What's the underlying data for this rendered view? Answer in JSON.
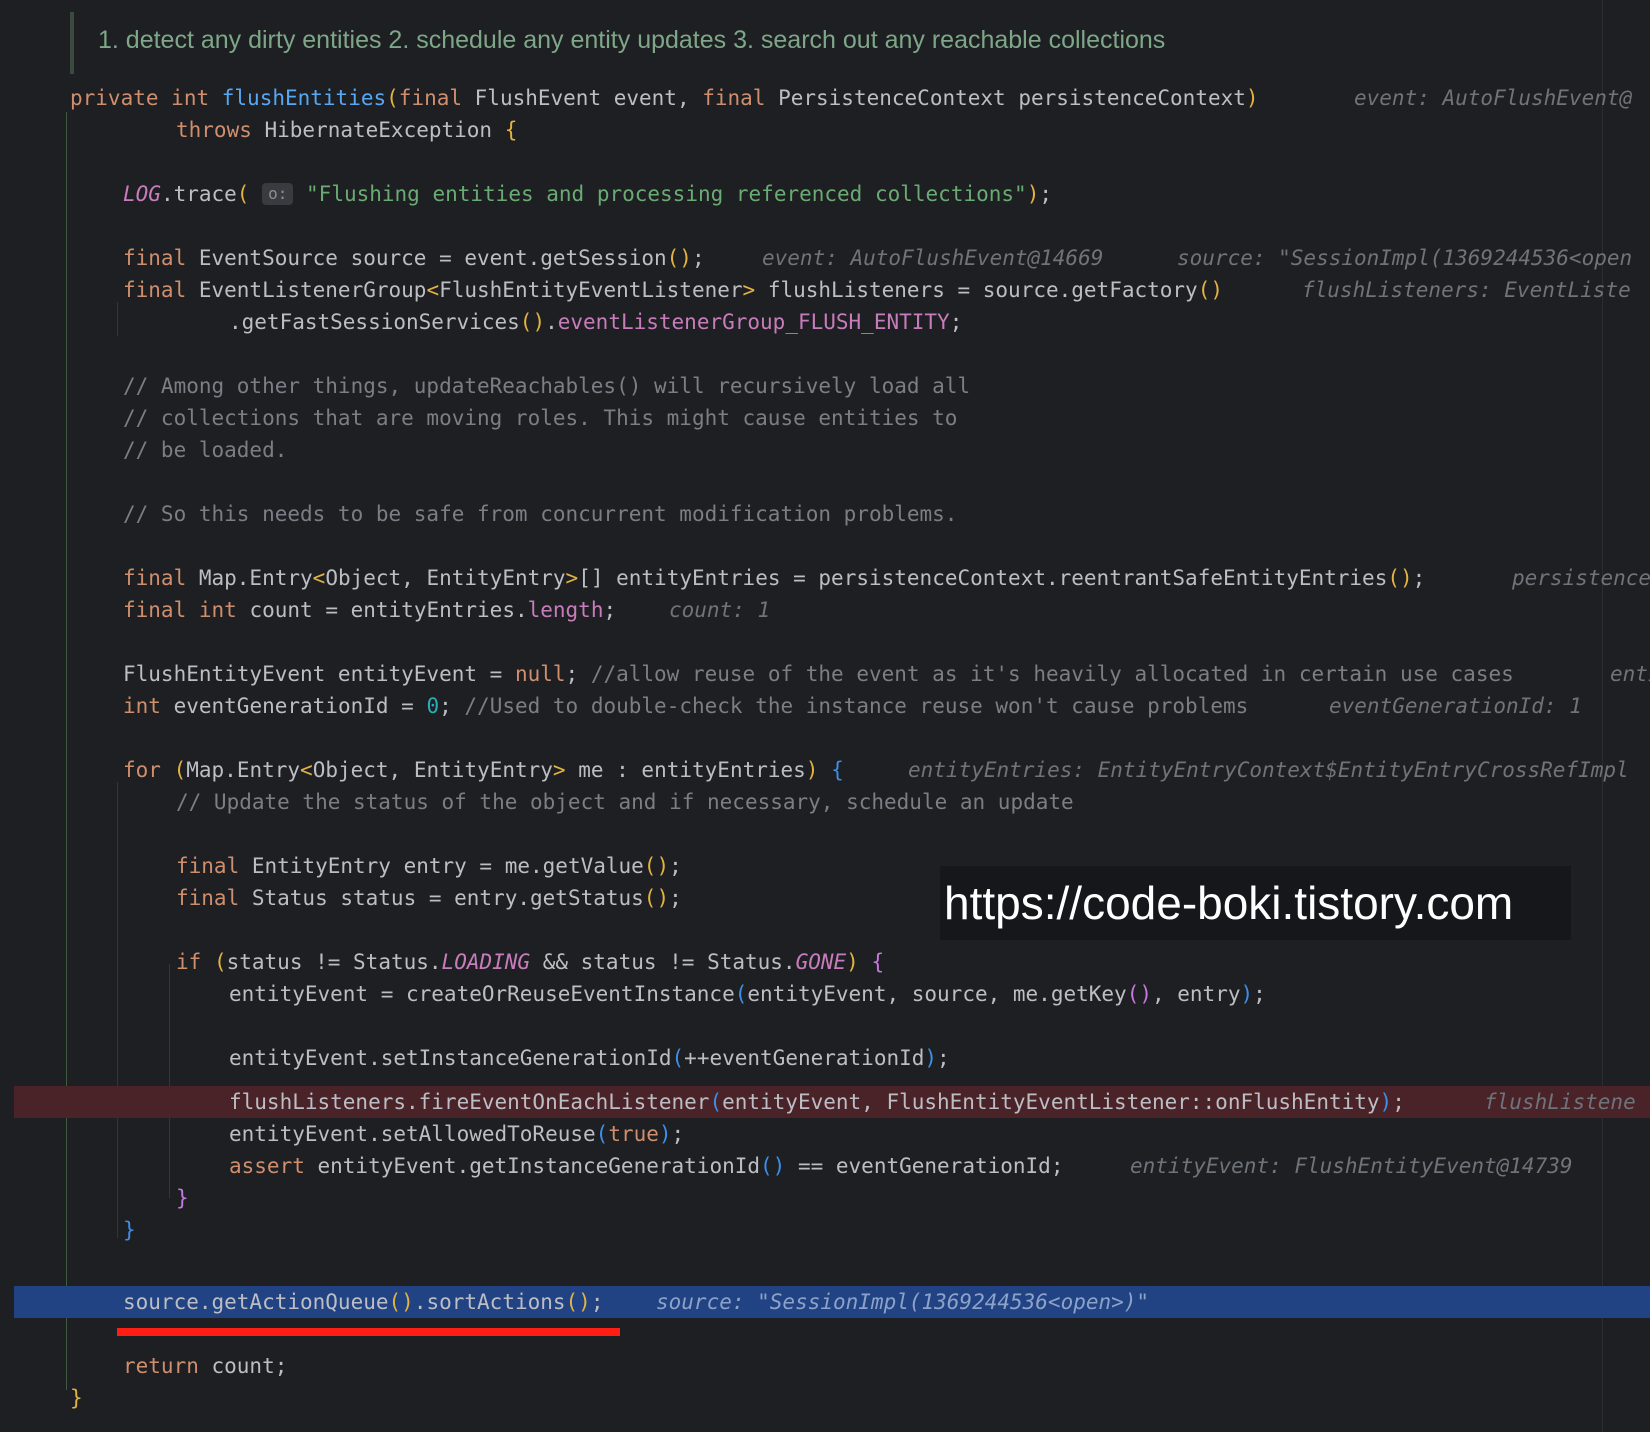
{
  "doc_comment": "1. detect any dirty entities 2. schedule any entity updates 3. search out any reachable collections",
  "code": {
    "l1": {
      "private": "private",
      "int": "int",
      "method": "flushEntities",
      "final1": "final",
      "t1": " FlushEvent event, ",
      "final2": "final",
      "t2": " PersistenceContext persistenceContext",
      "hint": "event: AutoFlushEvent@"
    },
    "l2": {
      "throws": "throws",
      "t": " HibernateException "
    },
    "l3": {
      "log": "LOG",
      "t": ".trace",
      "param_hint": "o:",
      "str": "\"Flushing entities and processing referenced collections\""
    },
    "l4": {
      "final": "final",
      "t": " EventSource source = event.getSession",
      "hint1": "event: AutoFlushEvent@14669",
      "hint2": "source: \"SessionImpl(1369244536<open"
    },
    "l5": {
      "final": "final",
      "t1": " EventListenerGroup",
      "t2": "FlushEntityEventListener",
      "t3": " flushListeners = source.getFactory",
      "hint": "flushListeners: EventListe"
    },
    "l6": {
      "t": ".getFastSessionServices",
      "field": "eventListenerGroup_FLUSH_ENTITY"
    },
    "c1": "// Among other things, updateReachables() will recursively load all",
    "c2": "// collections that are moving roles. This might cause entities to",
    "c3": "// be loaded.",
    "c4": "// So this needs to be safe from concurrent modification problems.",
    "l7": {
      "final": "final",
      "t1": " Map.Entry",
      "t2": "Object, EntityEntry",
      "t3": "[] entityEntries = persistenceContext.reentrantSafeEntityEntries",
      "hint": "persistence"
    },
    "l8": {
      "final": "final",
      "int": "int",
      "t": " count = entityEntries.",
      "field": "length",
      "hint": "count: 1"
    },
    "l9": {
      "t": "FlushEntityEvent entityEvent = ",
      "null": "null",
      "comment": "//allow reuse of the event as it's heavily allocated in certain use cases",
      "hint": "enti"
    },
    "l10": {
      "int": "int",
      "t": " eventGenerationId = ",
      "zero": "0",
      "comment": "//Used to double-check the instance reuse won't cause problems",
      "hint": "eventGenerationId: 1"
    },
    "l11": {
      "for": "for",
      "t1": "Map.Entry",
      "t2": "Object, EntityEntry",
      "t3": " me : entityEntries",
      "hint": "entityEntries: EntityEntryContext$EntityEntryCrossRefImpl"
    },
    "l12": "// Update the status of the object and if necessary, schedule an update",
    "l13": {
      "final": "final",
      "t": " EntityEntry entry = me.getValue"
    },
    "l14": {
      "final": "final",
      "t": " Status status = entry.getStatus"
    },
    "l15": {
      "if": "if",
      "t1": "status != Status.",
      "loading": "LOADING",
      "t2": " && status != Status.",
      "gone": "GONE"
    },
    "l16": {
      "t1": "entityEvent = createOrReuseEventInstance",
      "t2": "entityEvent, source, me.getKey",
      "t3": ", entry"
    },
    "l17": {
      "t1": "entityEvent.setInstanceGenerationId",
      "t2": "++eventGenerationId"
    },
    "l18": {
      "t1": "flushListeners.fireEventOnEachListener",
      "t2": "entityEvent, FlushEntityEventListener::onFlushEntity",
      "hint": "flushListene"
    },
    "l19": {
      "t1": "entityEvent.setAllowedToReuse",
      "true": "true"
    },
    "l20": {
      "assert": "assert",
      "t1": " entityEvent.getInstanceGenerationId",
      "t2": " == eventGenerationId;",
      "hint": "entityEvent: FlushEntityEvent@14739"
    },
    "l21": {
      "t1": "source.getActionQueue",
      "t2": ".sortActions",
      "hint": "source: \"SessionImpl(1369244536<open>)\""
    },
    "l22": {
      "return": "return",
      "t": " count;"
    }
  },
  "watermark": "https://code-boki.tistory.com",
  "colors": {
    "background": "#1e1f22",
    "keyword": "#cf8e6d",
    "method": "#56a8f5",
    "string": "#6aab73",
    "comment": "#7a7e85",
    "breakpoint_line": "#4a2329",
    "current_line": "#214283",
    "underline": "#ff1e14"
  }
}
